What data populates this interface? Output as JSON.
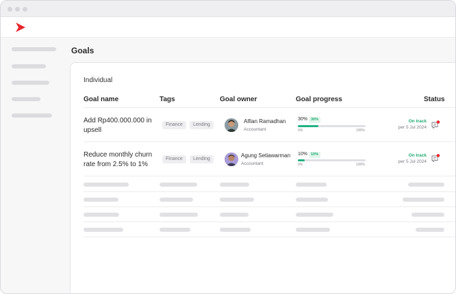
{
  "page": {
    "title": "Goals"
  },
  "section": {
    "label": "Individual"
  },
  "table": {
    "headers": {
      "goal_name": "Goal name",
      "tags": "Tags",
      "goal_owner": "Goal owner",
      "goal_progress": "Goal progress",
      "status": "Status"
    },
    "rows": [
      {
        "goal_name": "Add Rp400.000.000 in upsell",
        "tags": [
          "Finance",
          "Lending"
        ],
        "owner": {
          "name": "Alfian Ramadhan",
          "role": "Accountant"
        },
        "progress": {
          "label": "30%",
          "badge": "30%",
          "value": 30,
          "min_label": "0%",
          "max_label": "100%"
        },
        "status": {
          "label": "On track",
          "date": "per 5 Jul 2024"
        }
      },
      {
        "goal_name": "Reduce monthly churn rate from 2.5% to 1%",
        "tags": [
          "Finance",
          "Lending"
        ],
        "owner": {
          "name": "Agung Setiawarman",
          "role": "Accountant"
        },
        "progress": {
          "label": "10%",
          "badge": "10%",
          "value": 10,
          "min_label": "0%",
          "max_label": "100%"
        },
        "status": {
          "label": "On track",
          "date": "per 5 Jul 2024"
        }
      }
    ]
  },
  "icons": {
    "logo": "chevron-logo-icon",
    "comment": "comment-notification-icon"
  },
  "colors": {
    "brand": "#e8262d",
    "progress": "#21b283",
    "on_track": "#1fa971",
    "notification": "#e8262d"
  }
}
